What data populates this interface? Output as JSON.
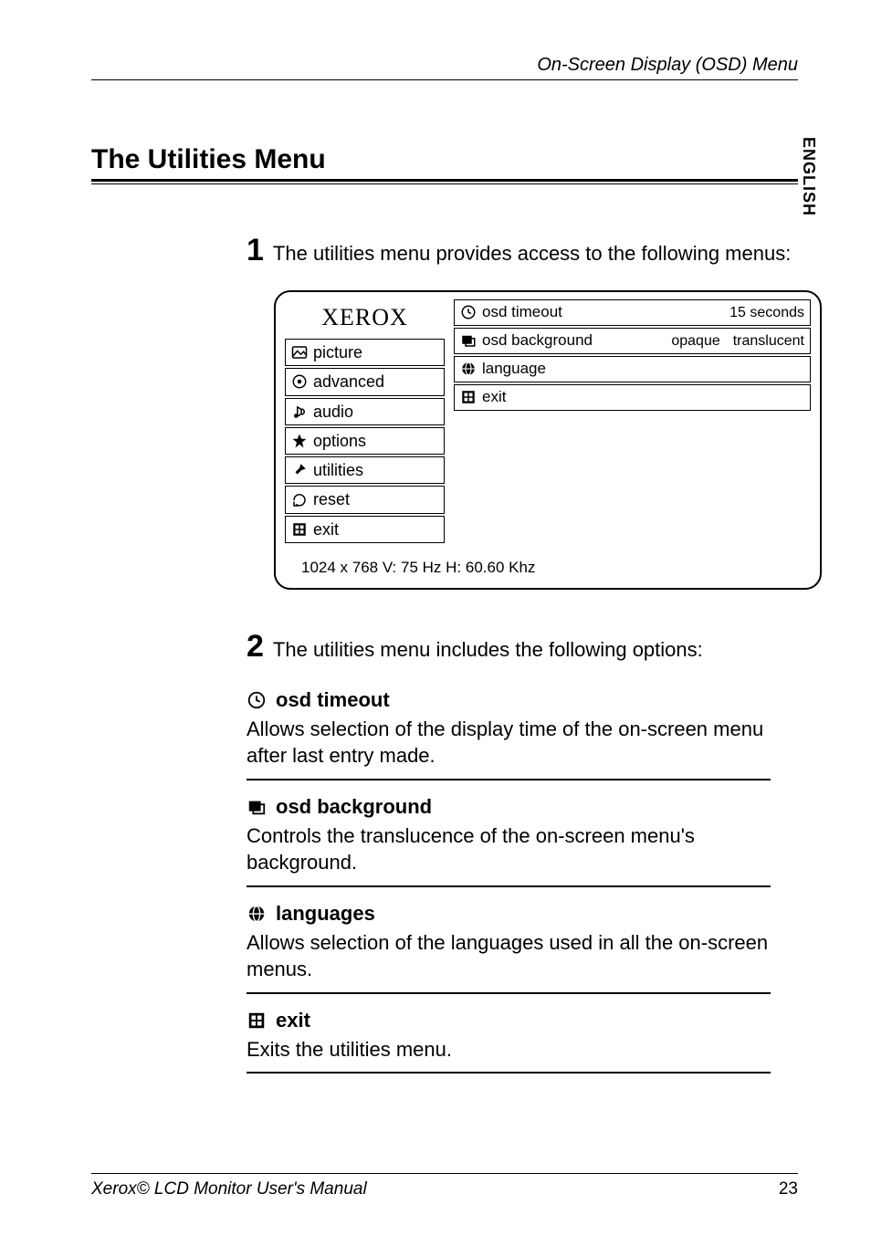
{
  "header": {
    "right": "On-Screen Display (OSD) Menu"
  },
  "side_tab": "ENGLISH",
  "section_title": "The Utilities Menu",
  "step1": {
    "num": "1",
    "text": "The utilities menu provides access to the following menus:"
  },
  "osd": {
    "brand": "XEROX",
    "left_items": [
      {
        "icon": "picture-icon",
        "label": "picture"
      },
      {
        "icon": "advanced-icon",
        "label": "advanced"
      },
      {
        "icon": "audio-icon",
        "label": "audio"
      },
      {
        "icon": "options-icon",
        "label": "options"
      },
      {
        "icon": "utilities-icon",
        "label": "utilities"
      },
      {
        "icon": "reset-icon",
        "label": "reset"
      },
      {
        "icon": "exit-icon",
        "label": "exit"
      }
    ],
    "right_rows": [
      {
        "icon": "clock-icon",
        "label": "osd timeout",
        "value": "15 seconds"
      },
      {
        "icon": "background-icon",
        "label": "osd background",
        "value_a": "opaque",
        "value_b": "translucent"
      },
      {
        "icon": "globe-icon",
        "label": "language",
        "value": ""
      },
      {
        "icon": "exit-grid-icon",
        "label": "exit",
        "value": ""
      }
    ],
    "status": "1024 x 768 V: 75 Hz   H: 60.60 Khz"
  },
  "step2": {
    "num": "2",
    "text": "The utilities menu includes the following options:"
  },
  "options": [
    {
      "icon": "clock-icon",
      "title": "osd timeout",
      "desc": " Allows selection of the display time of the on-screen menu after last entry made."
    },
    {
      "icon": "background-icon",
      "title": "osd background",
      "desc": "Controls the translucence of  the on-screen menu's background."
    },
    {
      "icon": "globe-icon",
      "title": "languages",
      "desc": "Allows selection of the languages used in all the on-screen menus."
    },
    {
      "icon": "exit-grid-icon",
      "title": "exit",
      "desc": "Exits the utilities menu."
    }
  ],
  "footer": {
    "left": "Xerox© LCD Monitor User's Manual",
    "page": "23"
  }
}
